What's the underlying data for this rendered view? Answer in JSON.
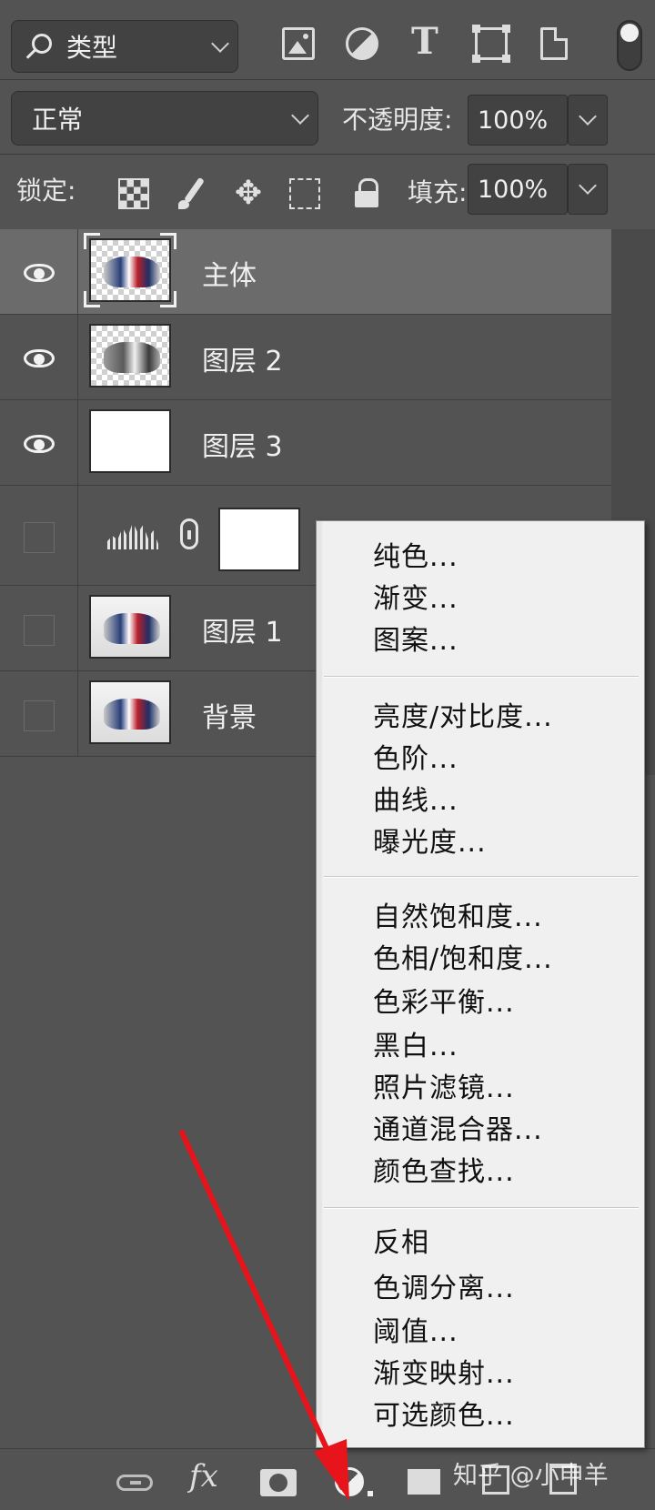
{
  "toolbar": {
    "filter_label": "类型",
    "icons": [
      "image-filter-icon",
      "adjustment-filter-icon",
      "type-filter-icon",
      "shape-filter-icon",
      "smart-object-filter-icon",
      "filter-toggle"
    ]
  },
  "blend": {
    "mode": "正常",
    "opacity_label": "不透明度:",
    "opacity_value": "100%"
  },
  "lock": {
    "label": "锁定:",
    "fill_label": "填充:",
    "fill_value": "100%"
  },
  "layers": [
    {
      "name": "主体",
      "visible": true,
      "selected": true
    },
    {
      "name": "图层 2",
      "visible": true,
      "selected": false
    },
    {
      "name": "图层 3",
      "visible": true,
      "selected": false
    },
    {
      "name": "",
      "visible": false,
      "selected": false,
      "type": "levels-adjustment"
    },
    {
      "name": "图层 1",
      "visible": false,
      "selected": false
    },
    {
      "name": "背景",
      "visible": false,
      "selected": false
    }
  ],
  "menu": {
    "groups": [
      [
        "纯色...",
        "渐变...",
        "图案..."
      ],
      [
        "亮度/对比度...",
        "色阶...",
        "曲线...",
        "曝光度..."
      ],
      [
        "自然饱和度...",
        "色相/饱和度...",
        "色彩平衡...",
        "黑白...",
        "照片滤镜...",
        "通道混合器...",
        "颜色查找..."
      ],
      [
        "反相",
        "色调分离...",
        "阈值...",
        "渐变映射...",
        "可选颜色..."
      ]
    ],
    "items": {
      "solid_color": "纯色...",
      "gradient": "渐变...",
      "pattern": "图案...",
      "brightness_contrast": "亮度/对比度...",
      "levels": "色阶...",
      "curves": "曲线...",
      "exposure": "曝光度...",
      "vibrance": "自然饱和度...",
      "hue_saturation": "色相/饱和度...",
      "color_balance": "色彩平衡...",
      "black_white": "黑白...",
      "photo_filter": "照片滤镜...",
      "channel_mixer": "通道混合器...",
      "color_lookup": "颜色查找...",
      "invert": "反相",
      "posterize": "色调分离...",
      "threshold": "阈值...",
      "gradient_map": "渐变映射...",
      "selective_color": "可选颜色..."
    }
  },
  "watermark": "知乎 @小申羊",
  "colors": {
    "panel_bg": "#535353",
    "selected_row": "#6b6b6b",
    "menu_bg": "#f0f0f0",
    "arrow": "#e8141b"
  }
}
